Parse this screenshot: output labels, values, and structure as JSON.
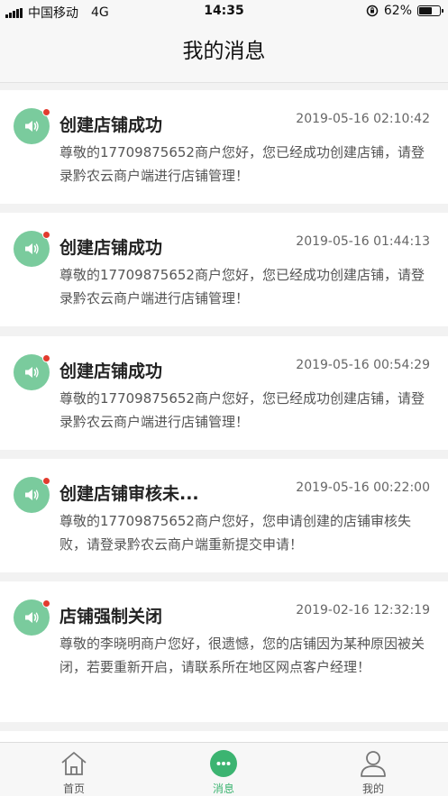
{
  "status_bar": {
    "carrier": "中国移动",
    "network": "4G",
    "time": "14:35",
    "battery": "62%",
    "battery_level": 0.62
  },
  "header": {
    "title": "我的消息"
  },
  "messages": [
    {
      "title": "创建店铺成功",
      "time": "2019-05-16 02:10:42",
      "body": "尊敬的17709875652商户您好，您已经成功创建店铺，请登录黔农云商户端进行店铺管理！",
      "unread": true
    },
    {
      "title": "创建店铺成功",
      "time": "2019-05-16 01:44:13",
      "body": "尊敬的17709875652商户您好，您已经成功创建店铺，请登录黔农云商户端进行店铺管理！",
      "unread": true
    },
    {
      "title": "创建店铺成功",
      "time": "2019-05-16 00:54:29",
      "body": "尊敬的17709875652商户您好，您已经成功创建店铺，请登录黔农云商户端进行店铺管理！",
      "unread": true
    },
    {
      "title": "创建店铺审核未...",
      "time": "2019-05-16 00:22:00",
      "body": "尊敬的17709875652商户您好，您申请创建的店铺审核失败，请登录黔农云商户端重新提交申请！",
      "unread": true
    },
    {
      "title": "店铺强制关闭",
      "time": "2019-02-16 12:32:19",
      "body": "尊敬的李晓明商户您好，很遗憾，您的店铺因为某种原因被关闭，若要重新开启，请联系所在地区网点客户经理！",
      "unread": true
    }
  ],
  "tabs": [
    {
      "label": "首页",
      "icon": "home-icon",
      "active": false
    },
    {
      "label": "消息",
      "icon": "chat-icon",
      "active": true
    },
    {
      "label": "我的",
      "icon": "user-icon",
      "active": false
    }
  ],
  "colors": {
    "accent": "#3cb471",
    "icon_bg": "#7acb9d",
    "unread_dot": "#e23b2e"
  }
}
